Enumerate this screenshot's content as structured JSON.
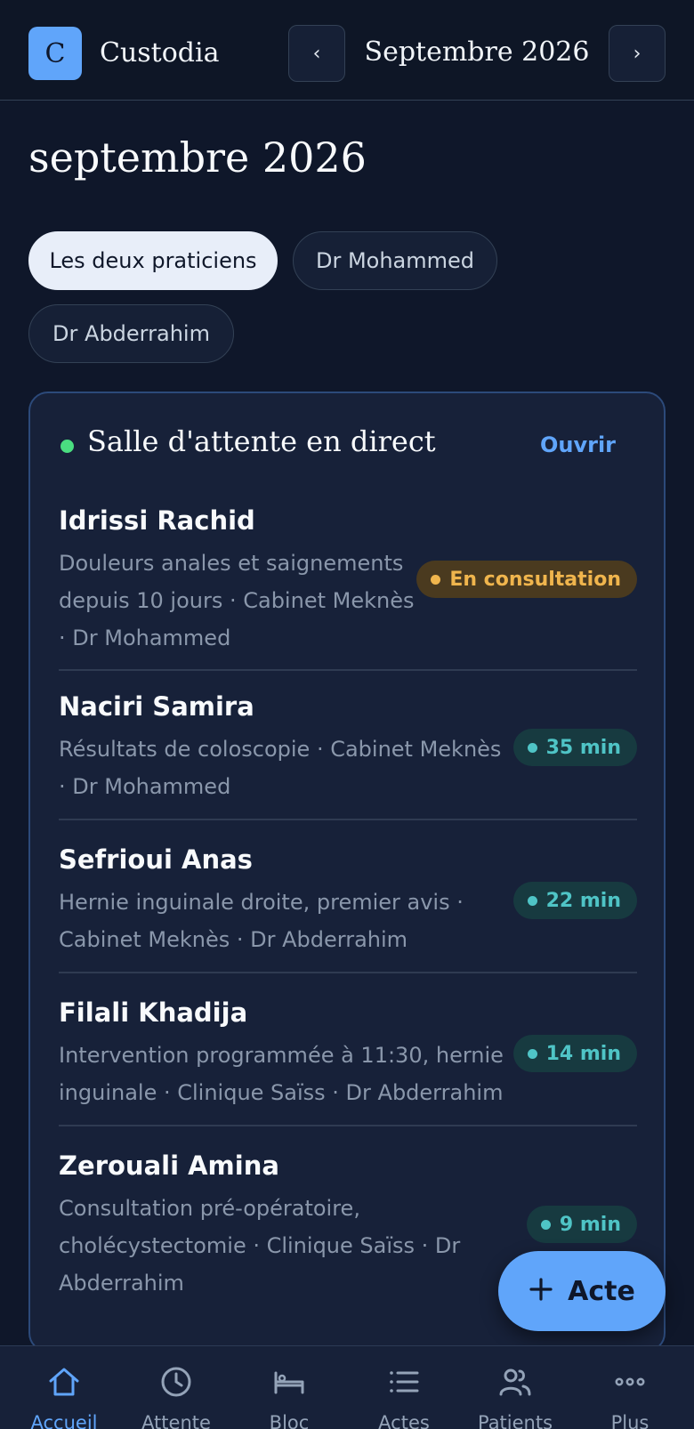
{
  "header": {
    "logo_letter": "C",
    "app_name": "Custodia",
    "prev_label": "‹",
    "next_label": "›",
    "month": "Septembre 2026"
  },
  "page_title": "septembre 2026",
  "filters": [
    {
      "label": "Les deux praticiens",
      "active": true
    },
    {
      "label": "Dr Mohammed",
      "active": false
    },
    {
      "label": "Dr Abderrahim",
      "active": false
    }
  ],
  "waiting_room": {
    "title": "Salle d'attente en direct",
    "open_label": "Ouvrir",
    "live_color": "#4ade80",
    "patients": [
      {
        "name": "Idrissi Rachid",
        "desc_lines": [
          "Douleurs anales et saignements",
          "depuis 10 jours · Cabinet Meknès",
          "· Dr Mohammed"
        ],
        "badge": "En consultation",
        "status": "consultation"
      },
      {
        "name": "Naciri Samira",
        "desc_lines": [
          "Résultats de coloscopie · Cabinet Meknès",
          "· Dr Mohammed"
        ],
        "badge": "35 min",
        "status": "waiting"
      },
      {
        "name": "Sefrioui Anas",
        "desc_lines": [
          "Hernie inguinale droite, premier avis ·",
          "Cabinet Meknès · Dr Abderrahim"
        ],
        "badge": "22 min",
        "status": "waiting"
      },
      {
        "name": "Filali Khadija",
        "desc_lines": [
          "Intervention programmée à 11:30, hernie",
          "inguinale · Clinique Saïss · Dr Abderrahim"
        ],
        "badge": "14 min",
        "status": "waiting"
      },
      {
        "name": "Zerouali Amina",
        "desc_lines": [
          "Consultation pré-opératoire,",
          "cholécystectomie · Clinique Saïss · Dr",
          "Abderrahim"
        ],
        "badge": "9 min",
        "status": "waiting"
      }
    ]
  },
  "fab": {
    "icon": "plus-icon",
    "label": "Acte"
  },
  "bottom_nav": [
    {
      "label": "Accueil",
      "icon": "home-icon",
      "active": true
    },
    {
      "label": "Attente",
      "icon": "clock-icon",
      "active": false
    },
    {
      "label": "Bloc",
      "icon": "bed-icon",
      "active": false
    },
    {
      "label": "Actes",
      "icon": "list-icon",
      "active": false
    },
    {
      "label": "Patients",
      "icon": "users-icon",
      "active": false
    },
    {
      "label": "Plus",
      "icon": "more-icon",
      "active": false
    }
  ],
  "colors": {
    "background": "#0f172a",
    "accent": "#60a5fa",
    "consultation": "#f0b54d",
    "waiting": "#4fc4c6"
  }
}
